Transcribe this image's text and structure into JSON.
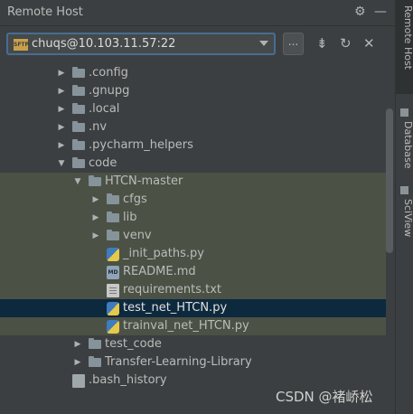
{
  "header": {
    "title": "Remote Host"
  },
  "toolbar": {
    "host": "chuqs@10.103.11.57:22",
    "sftp_badge": "SFTP",
    "ellipsis": "..."
  },
  "tree": {
    "rows": [
      {
        "label": ".config",
        "type": "folder",
        "expanded": false
      },
      {
        "label": ".gnupg",
        "type": "folder",
        "expanded": false
      },
      {
        "label": ".local",
        "type": "folder",
        "expanded": false
      },
      {
        "label": ".nv",
        "type": "folder",
        "expanded": false
      },
      {
        "label": ".pycharm_helpers",
        "type": "folder",
        "expanded": false
      },
      {
        "label": "code",
        "type": "folder",
        "expanded": true
      },
      {
        "label": "HTCN-master",
        "type": "folder",
        "expanded": true
      },
      {
        "label": "cfgs",
        "type": "folder",
        "expanded": false
      },
      {
        "label": "lib",
        "type": "folder",
        "expanded": false
      },
      {
        "label": "venv",
        "type": "folder",
        "expanded": false
      },
      {
        "label": "_init_paths.py",
        "type": "py"
      },
      {
        "label": "README.md",
        "type": "md",
        "badge": "MD"
      },
      {
        "label": "requirements.txt",
        "type": "txt"
      },
      {
        "label": "test_net_HTCN.py",
        "type": "py",
        "selected": true
      },
      {
        "label": "trainval_net_HTCN.py",
        "type": "py"
      },
      {
        "label": "test_code",
        "type": "folder",
        "expanded": false
      },
      {
        "label": "Transfer-Learning-Library",
        "type": "folder",
        "expanded": false
      },
      {
        "label": ".bash_history",
        "type": "file"
      }
    ]
  },
  "sidebar": {
    "tabs": [
      {
        "label": "Remote Host",
        "active": true
      },
      {
        "label": "Database",
        "active": false
      },
      {
        "label": "SciView",
        "active": false
      }
    ]
  },
  "watermark": "CSDN @褚峤松"
}
